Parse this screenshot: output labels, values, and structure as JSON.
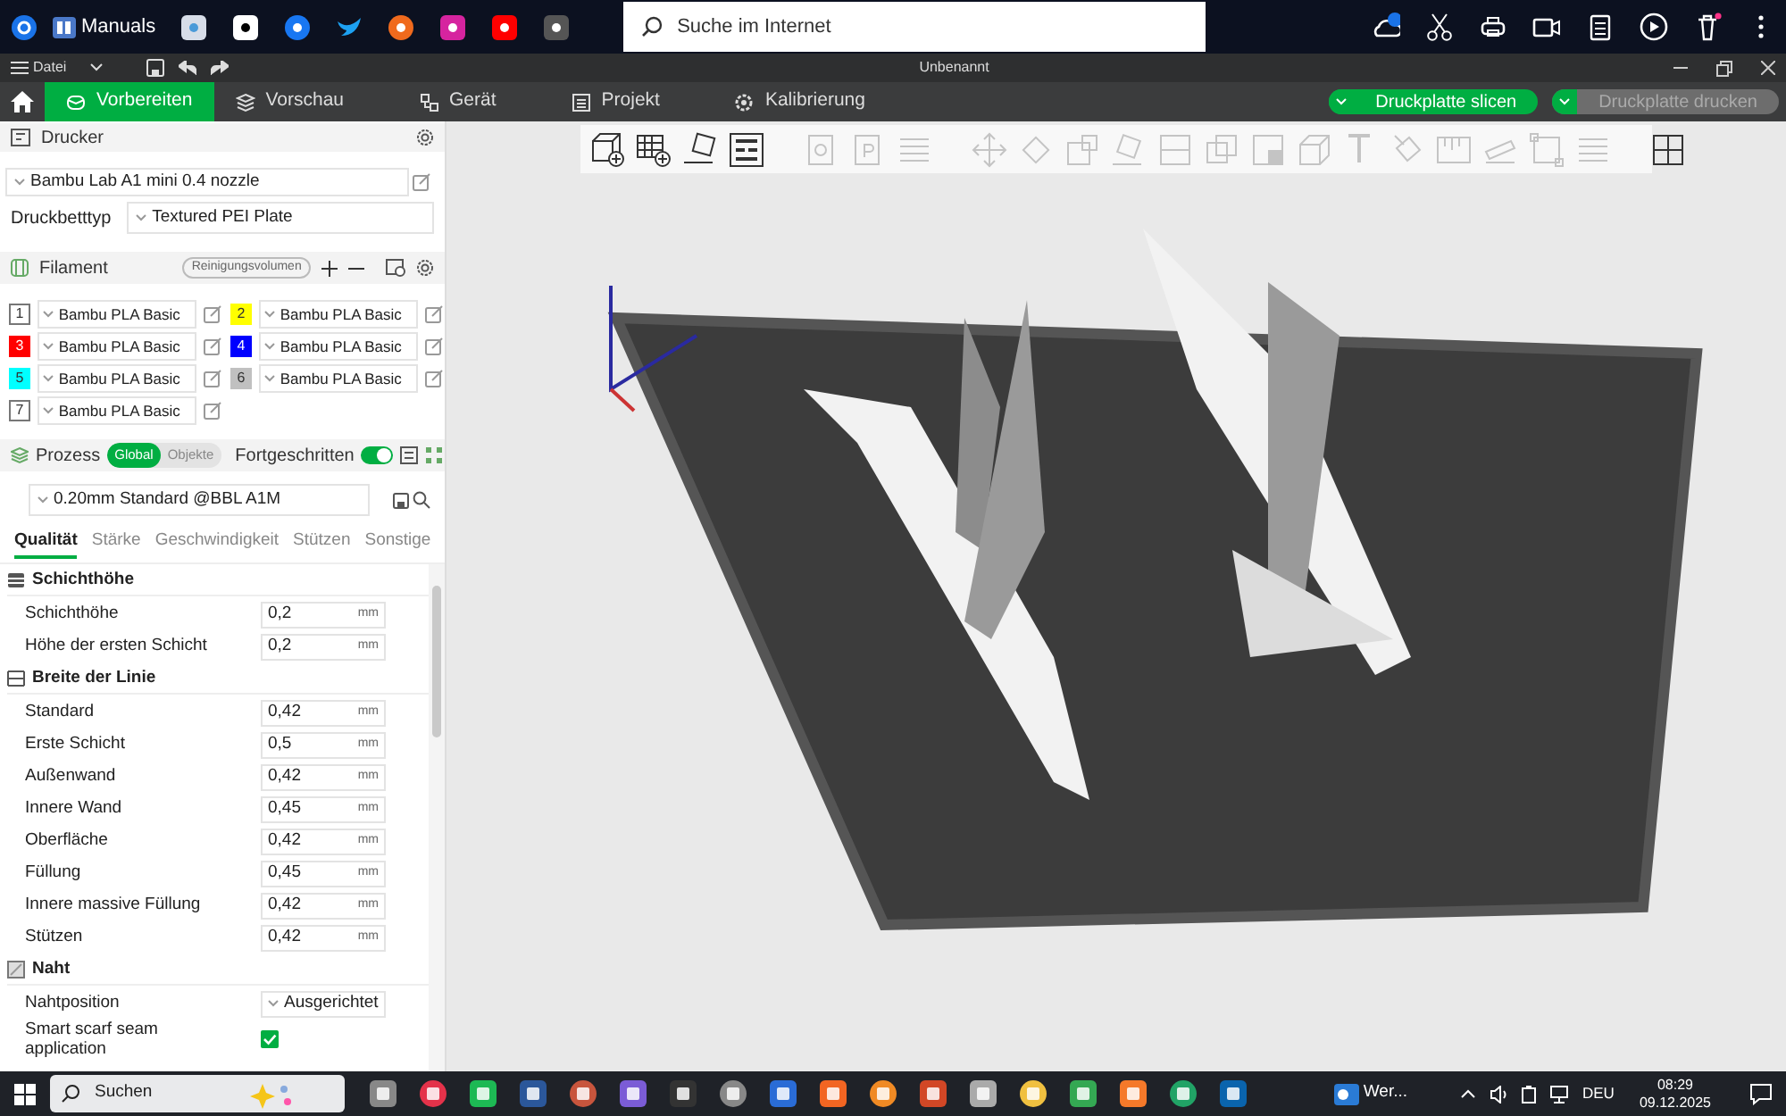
{
  "browser_bar": {
    "bookmark": "Manuals",
    "search": {
      "placeholder": "Suche im Internet"
    }
  },
  "menu_bar": {
    "file_menu": "Datei",
    "title": "Unbenannt"
  },
  "tabs": [
    {
      "label": "Vorbereiten",
      "selected": true
    },
    {
      "label": "Vorschau",
      "selected": false
    },
    {
      "label": "Gerät",
      "selected": false
    },
    {
      "label": "Projekt",
      "selected": false
    },
    {
      "label": "Kalibrierung",
      "selected": false
    }
  ],
  "actions": [
    {
      "label": "Druckplatte slicen",
      "disabled": false
    },
    {
      "label": "Druckplatte drucken",
      "disabled": true
    }
  ],
  "printer": {
    "title": "Drucker",
    "preset": "Bambu Lab A1 mini 0.4 nozzle",
    "bed_label": "Druckbetttyp",
    "bed_type": "Textured PEI Plate"
  },
  "filament": {
    "title": "Filament",
    "purge_button": "Reinigungsvolumen",
    "slots": [
      {
        "number": "1",
        "color": "#ffffff",
        "name": "Bambu PLA Basic"
      },
      {
        "number": "2",
        "color": "#ffff00",
        "name": "Bambu PLA Basic"
      },
      {
        "number": "3",
        "color": "#ff0000",
        "name": "Bambu PLA Basic"
      },
      {
        "number": "4",
        "color": "#0000ff",
        "name": "Bambu PLA Basic"
      },
      {
        "number": "5",
        "color": "#00ffff",
        "name": "Bambu PLA Basic"
      },
      {
        "number": "6",
        "color": "#c0c0c0",
        "name": "Bambu PLA Basic"
      },
      {
        "number": "7",
        "color": "#ffffff",
        "name": "Bambu PLA Basic"
      }
    ]
  },
  "process": {
    "title": "Prozess",
    "scope": [
      {
        "label": "Global",
        "selected": true
      },
      {
        "label": "Objekte",
        "selected": false
      }
    ],
    "advanced_label": "Fortgeschritten",
    "advanced_on": true,
    "preset": "0.20mm Standard @BBL A1M",
    "tabs": [
      {
        "label": "Qualität",
        "selected": true
      },
      {
        "label": "Stärke",
        "selected": false
      },
      {
        "label": "Geschwindigkeit",
        "selected": false
      },
      {
        "label": "Stützen",
        "selected": false
      },
      {
        "label": "Sonstige",
        "selected": false
      }
    ],
    "groups": [
      {
        "title": "Schichthöhe",
        "settings": [
          {
            "kind": "number",
            "label": "Schichthöhe",
            "value": "0,2",
            "unit": "mm"
          },
          {
            "kind": "number",
            "label": "Höhe der ersten Schicht",
            "value": "0,2",
            "unit": "mm"
          }
        ]
      },
      {
        "title": "Breite der Linie",
        "settings": [
          {
            "kind": "number",
            "label": "Standard",
            "value": "0,42",
            "unit": "mm"
          },
          {
            "kind": "number",
            "label": "Erste Schicht",
            "value": "0,5",
            "unit": "mm"
          },
          {
            "kind": "number",
            "label": "Außenwand",
            "value": "0,42",
            "unit": "mm"
          },
          {
            "kind": "number",
            "label": "Innere Wand",
            "value": "0,45",
            "unit": "mm"
          },
          {
            "kind": "number",
            "label": "Oberfläche",
            "value": "0,42",
            "unit": "mm"
          },
          {
            "kind": "number",
            "label": "Füllung",
            "value": "0,45",
            "unit": "mm"
          },
          {
            "kind": "number",
            "label": "Innere massive Füllung",
            "value": "0,42",
            "unit": "mm"
          },
          {
            "kind": "number",
            "label": "Stützen",
            "value": "0,42",
            "unit": "mm"
          }
        ]
      },
      {
        "title": "Naht",
        "settings": [
          {
            "kind": "select",
            "label": "Nahtposition",
            "value": "Ausgerichtet"
          },
          {
            "kind": "checkbox",
            "label": "Smart scarf seam application",
            "checked": true
          }
        ]
      }
    ]
  },
  "toolbar": [
    {
      "disabled": false
    },
    {
      "disabled": false
    },
    {
      "disabled": false
    },
    {
      "disabled": false
    },
    {
      "disabled": true
    },
    {
      "disabled": true
    },
    {
      "disabled": true
    },
    {
      "disabled": true
    },
    {
      "disabled": true
    },
    {
      "disabled": true
    },
    {
      "disabled": true
    },
    {
      "disabled": true
    },
    {
      "disabled": true
    },
    {
      "disabled": true
    },
    {
      "disabled": true
    },
    {
      "disabled": true
    },
    {
      "disabled": true
    },
    {
      "disabled": true
    },
    {
      "disabled": true
    },
    {
      "disabled": true
    },
    {
      "disabled": true
    },
    {
      "disabled": false
    }
  ],
  "taskbar": {
    "search_placeholder": "Suchen",
    "weather": "Wer...",
    "language": "DEU",
    "time": "08:29",
    "date": "09.12.2025"
  }
}
